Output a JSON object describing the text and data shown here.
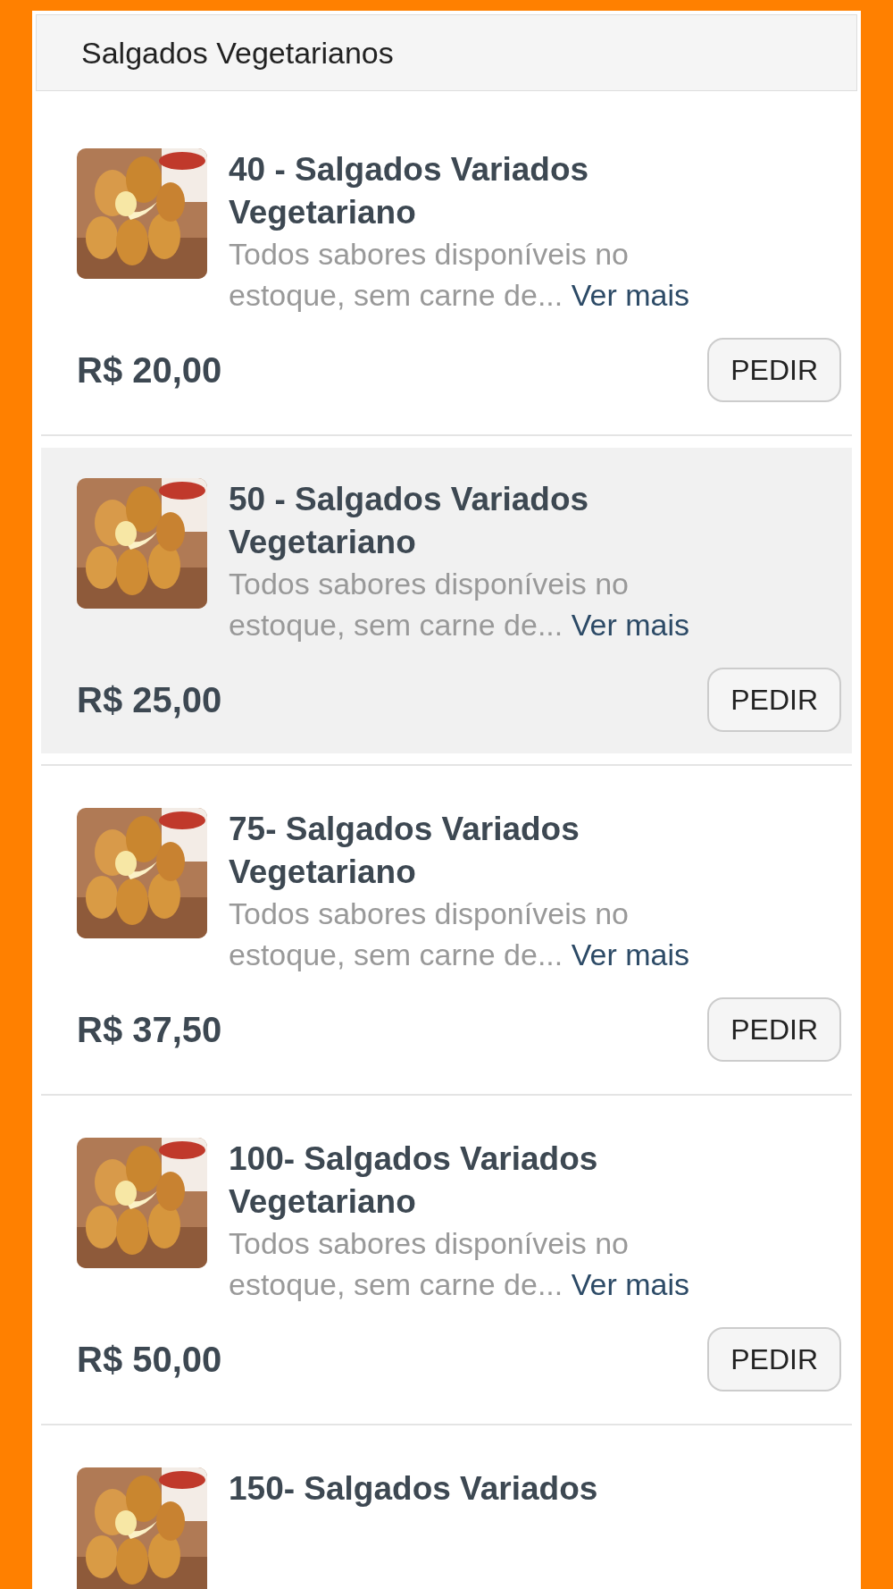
{
  "section": {
    "title": "Salgados Vegetarianos"
  },
  "items": [
    {
      "title": "40 - Salgados Variados Vegetariano",
      "description": "Todos sabores disponíveis no estoque, sem carne de...",
      "link": "Ver mais",
      "price": "R$ 20,00",
      "button": "PEDIR",
      "selected": false
    },
    {
      "title": "50 - Salgados Variados Vegetariano",
      "description": "Todos sabores disponíveis no estoque, sem carne de...",
      "link": "Ver mais",
      "price": "R$ 25,00",
      "button": "PEDIR",
      "selected": true
    },
    {
      "title": "75- Salgados Variados Vegetariano",
      "description": "Todos sabores disponíveis no estoque, sem carne de...",
      "link": "Ver mais",
      "price": "R$ 37,50",
      "button": "PEDIR",
      "selected": false
    },
    {
      "title": "100- Salgados Variados Vegetariano",
      "description": "Todos sabores disponíveis no estoque, sem carne de...",
      "link": "Ver mais",
      "price": "R$ 50,00",
      "button": "PEDIR",
      "selected": false
    },
    {
      "title": "150- Salgados Variados",
      "selected": false
    }
  ]
}
